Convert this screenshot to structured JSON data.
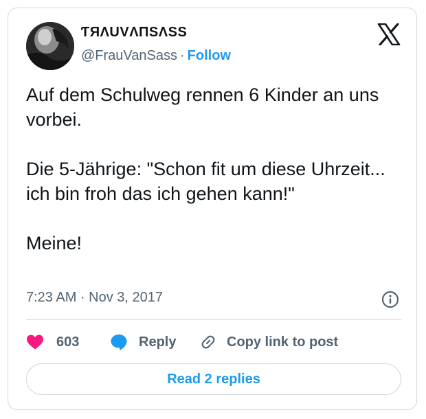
{
  "author": {
    "display_name": "ƬЯΛUVΛПSΛSS",
    "handle": "@FrauVanSass",
    "separator": "·",
    "follow_label": "Follow"
  },
  "tweet": {
    "paragraphs": [
      "Auf dem Schulweg rennen 6 Kinder an uns vorbei.",
      "Die 5-Jährige: \"Schon fit um diese Uhrzeit... ich bin froh das ich gehen kann!\"",
      "Meine!"
    ],
    "timestamp": "7:23 AM · Nov 3, 2017"
  },
  "actions": {
    "like_count": "603",
    "reply_label": "Reply",
    "copy_link_label": "Copy link to post"
  },
  "replies_button": {
    "label": "Read 2 replies"
  },
  "icons": {
    "platform": "x-logo-icon",
    "info": "info-icon",
    "like": "heart-icon",
    "reply": "speech-bubble-icon",
    "copy_link": "link-icon"
  },
  "colors": {
    "accent": "#1d9bf0",
    "like": "#f91880",
    "text": "#0f1419",
    "secondary_text": "#536471",
    "border": "#cfd9de"
  }
}
